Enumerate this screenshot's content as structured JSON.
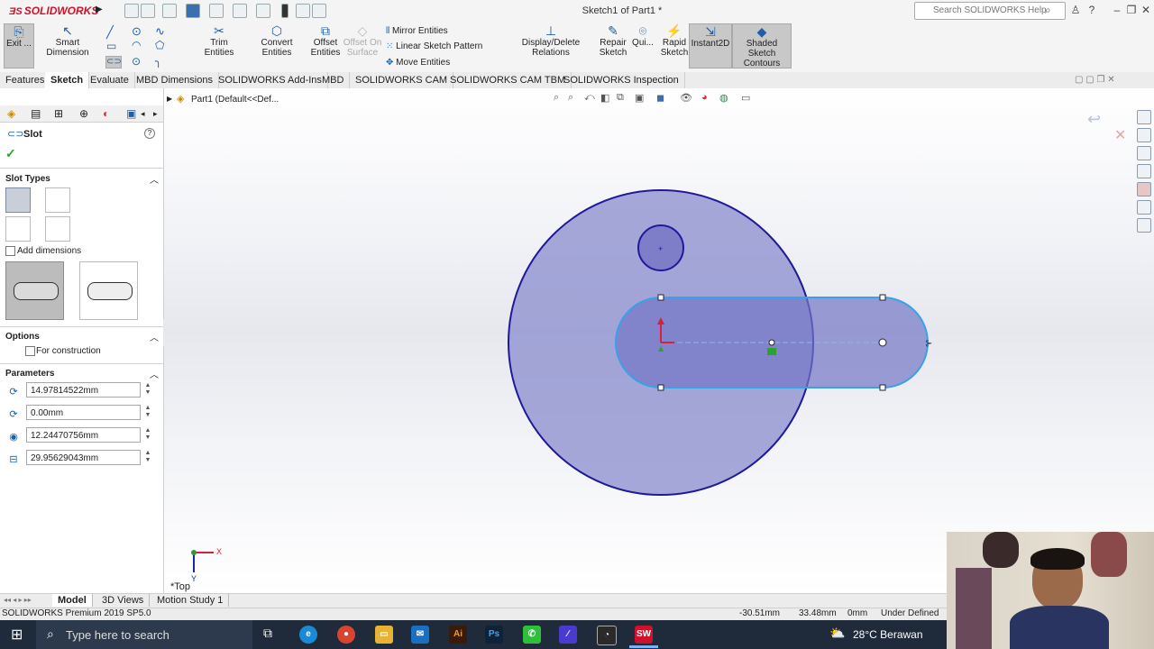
{
  "window": {
    "app_logo_text": "SOLIDWORKS",
    "title": "Sketch1 of Part1 *",
    "search_placeholder": "Search SOLIDWORKS Help"
  },
  "command_manager": {
    "exit_sketch": "Exit ...",
    "smart_dimension": "Smart Dimension",
    "trim_entities": "Trim Entities",
    "convert_entities": "Convert Entities",
    "offset_entities_line1": "Offset",
    "offset_entities_line2": "Entities",
    "offset_on_surface_line1": "Offset On",
    "offset_on_surface_line2": "Surface",
    "mirror_entities": "Mirror Entities",
    "linear_sketch_pattern": "Linear Sketch Pattern",
    "move_entities": "Move Entities",
    "display_delete_relations": "Display/Delete Relations",
    "repair_sketch_line1": "Repair",
    "repair_sketch_line2": "Sketch",
    "quick_snaps": "Qui...",
    "rapid_sketch_line1": "Rapid",
    "rapid_sketch_line2": "Sketch",
    "instant2d": "Instant2D",
    "shaded_sketch_line1": "Shaded Sketch",
    "shaded_sketch_line2": "Contours"
  },
  "tabs": [
    {
      "label": "Features"
    },
    {
      "label": "Sketch"
    },
    {
      "label": "Evaluate"
    },
    {
      "label": "MBD Dimensions"
    },
    {
      "label": "SOLIDWORKS Add-Ins"
    },
    {
      "label": "MBD"
    },
    {
      "label": "SOLIDWORKS CAM"
    },
    {
      "label": "SOLIDWORKS CAM TBM"
    },
    {
      "label": "SOLIDWORKS Inspection"
    }
  ],
  "tree": {
    "part_label": "Part1  (Default<<Def..."
  },
  "property_manager": {
    "title": "Slot",
    "slot_types_header": "Slot Types",
    "add_dimensions_label": "Add dimensions",
    "options_header": "Options",
    "for_construction_label": "For construction",
    "parameters_header": "Parameters",
    "parameters": [
      {
        "icon": "x-coordinate-icon",
        "value": "14.97814522mm"
      },
      {
        "icon": "y-coordinate-icon",
        "value": "0.00mm"
      },
      {
        "icon": "slot-width-icon",
        "value": "12.24470756mm"
      },
      {
        "icon": "slot-length-icon",
        "value": "29.95629043mm"
      }
    ]
  },
  "viewport": {
    "view_orientation": "*Top",
    "triad_x": "X",
    "triad_y": "Y"
  },
  "bottom_tabs": [
    {
      "label": "Model"
    },
    {
      "label": "3D Views"
    },
    {
      "label": "Motion Study 1"
    }
  ],
  "status": {
    "product": "SOLIDWORKS Premium 2019 SP5.0",
    "x": "-30.51mm",
    "y": "33.48mm",
    "z": "0mm",
    "state": "Under Defined"
  },
  "taskbar": {
    "search_placeholder": "Type here to search",
    "weather": "28°C  Berawan"
  },
  "colors": {
    "sketch_fill": "#8a8ccd",
    "sketch_outline": "#1f1a9a",
    "selected_outline": "#3aa0e8",
    "brand_red": "#d0112b"
  }
}
